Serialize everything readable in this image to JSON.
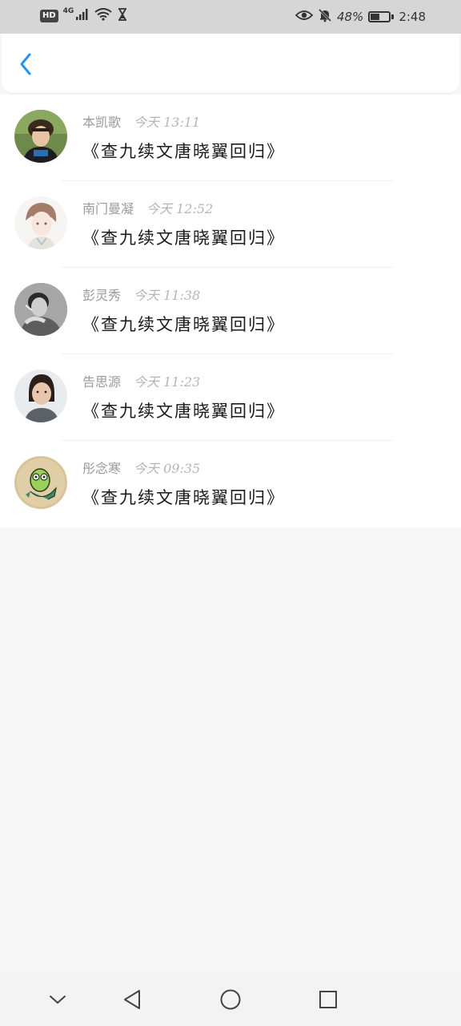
{
  "status_bar": {
    "network_badge": "HD",
    "network_type": "4G",
    "battery_percent": "48%",
    "time": "2:48",
    "battery_level": 0.48
  },
  "header": {
    "back_icon": "chevron-left-icon",
    "accent_color": "#2196f3"
  },
  "messages": [
    {
      "name": "本凯歌",
      "time": "今天 13:11",
      "content": "《查九续文唐晓翼回归》",
      "avatar": "avatar-boy-cap"
    },
    {
      "name": "南门曼凝",
      "time": "今天 12:52",
      "content": "《查九续文唐晓翼回归》",
      "avatar": "avatar-anime-boy"
    },
    {
      "name": "彭灵秀",
      "time": "今天 11:38",
      "content": "《查九续文唐晓翼回归》",
      "avatar": "avatar-man-smoking"
    },
    {
      "name": "告思源",
      "time": "今天 11:23",
      "content": "《查九续文唐晓翼回归》",
      "avatar": "avatar-woman"
    },
    {
      "name": "彤念寒",
      "time": "今天 09:35",
      "content": "《查九续文唐晓翼回归》",
      "avatar": "avatar-cartoon-fish"
    }
  ],
  "nav_bar": {
    "icons": [
      "chevron-down-icon",
      "back-triangle-icon",
      "home-circle-icon",
      "recents-square-icon"
    ]
  }
}
